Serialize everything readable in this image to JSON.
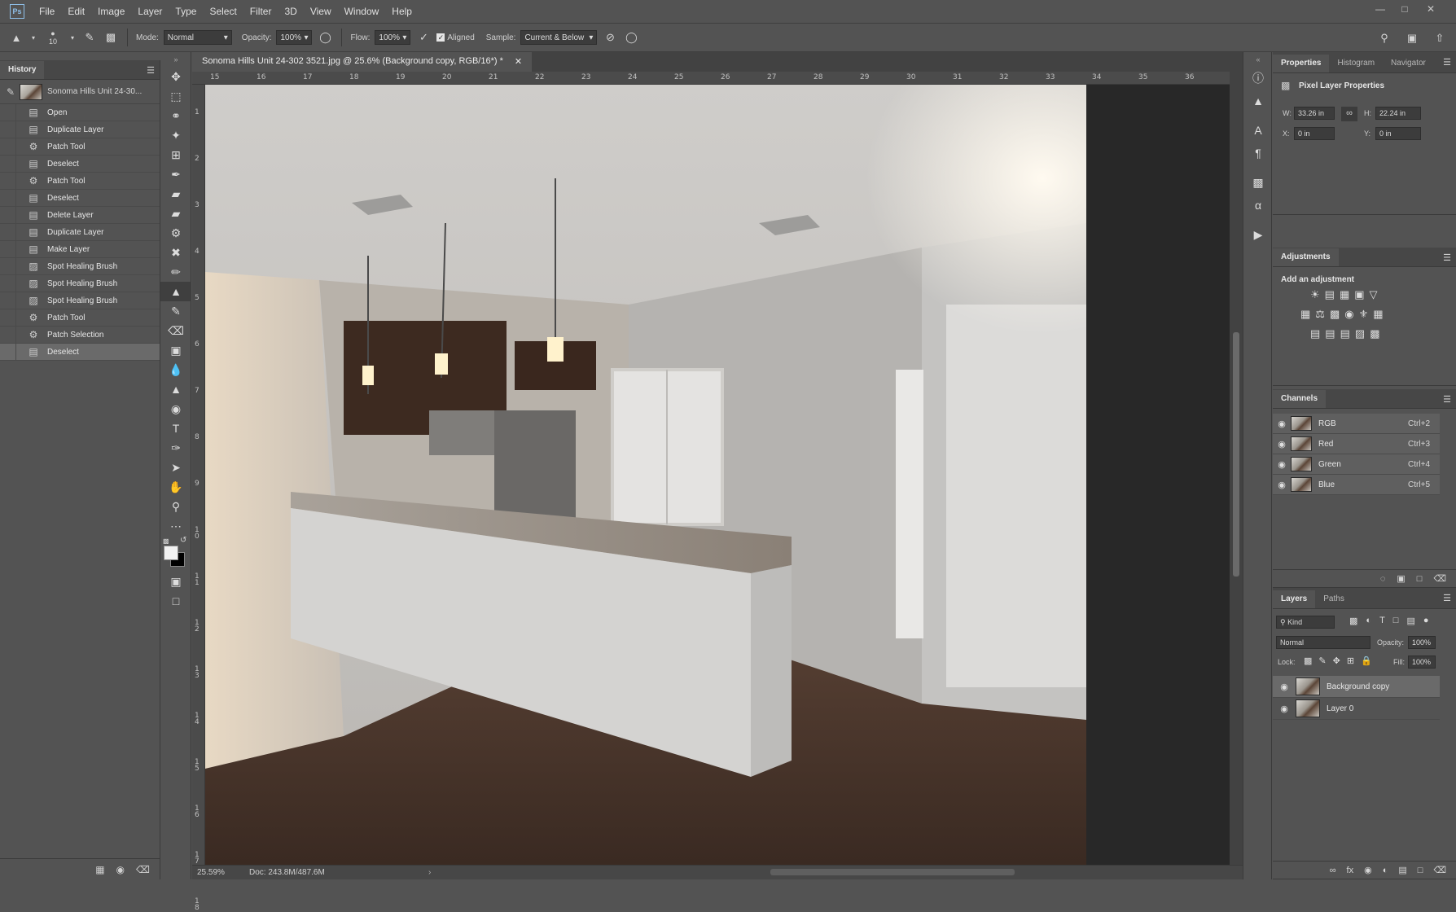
{
  "menubar": {
    "logo": "Ps",
    "items": [
      "File",
      "Edit",
      "Image",
      "Layer",
      "Type",
      "Select",
      "Filter",
      "3D",
      "View",
      "Window",
      "Help"
    ]
  },
  "options": {
    "brush_size": "10",
    "mode_label": "Mode:",
    "mode_value": "Normal",
    "opacity_label": "Opacity:",
    "opacity_value": "100%",
    "flow_label": "Flow:",
    "flow_value": "100%",
    "aligned_label": "Aligned",
    "sample_label": "Sample:",
    "sample_value": "Current & Below"
  },
  "history": {
    "tab_label": "History",
    "snapshot_label": "Sonoma Hills Unit 24-30...",
    "items": [
      {
        "label": "Open",
        "icon": "document-icon"
      },
      {
        "label": "Duplicate Layer",
        "icon": "document-icon"
      },
      {
        "label": "Patch Tool",
        "icon": "patch-icon"
      },
      {
        "label": "Deselect",
        "icon": "document-icon"
      },
      {
        "label": "Patch Tool",
        "icon": "patch-icon"
      },
      {
        "label": "Deselect",
        "icon": "document-icon"
      },
      {
        "label": "Delete Layer",
        "icon": "document-icon"
      },
      {
        "label": "Duplicate Layer",
        "icon": "document-icon"
      },
      {
        "label": "Make Layer",
        "icon": "document-icon"
      },
      {
        "label": "Spot Healing Brush",
        "icon": "bandage-icon"
      },
      {
        "label": "Spot Healing Brush",
        "icon": "bandage-icon"
      },
      {
        "label": "Spot Healing Brush",
        "icon": "bandage-icon"
      },
      {
        "label": "Patch Tool",
        "icon": "patch-icon"
      },
      {
        "label": "Patch Selection",
        "icon": "patch-icon"
      },
      {
        "label": "Deselect",
        "icon": "document-icon"
      }
    ]
  },
  "document": {
    "tab_title": "Sonoma Hills Unit 24-302 3521.jpg @ 25.6% (Background copy, RGB/16*) *",
    "zoom": "25.59%",
    "doc_size": "Doc: 243.8M/487.6M",
    "ruler_top": [
      "15",
      "16",
      "17",
      "18",
      "19",
      "20",
      "21",
      "22",
      "23",
      "24",
      "25",
      "26",
      "27",
      "28",
      "29",
      "30",
      "31",
      "32",
      "33",
      "34",
      "35",
      "36"
    ],
    "ruler_left": [
      "1",
      "2",
      "3",
      "4",
      "5",
      "6",
      "7",
      "8",
      "9",
      "1 0",
      "1 1",
      "1 2",
      "1 3",
      "1 4",
      "1 5",
      "1 6",
      "1 7",
      "1 8"
    ]
  },
  "properties": {
    "tabs": [
      "Properties",
      "Histogram",
      "Navigator"
    ],
    "section_title": "Pixel Layer Properties",
    "w_label": "W:",
    "w_value": "33.26 in",
    "h_label": "H:",
    "h_value": "22.24 in",
    "x_label": "X:",
    "x_value": "0 in",
    "y_label": "Y:",
    "y_value": "0 in"
  },
  "adjustments": {
    "tab_label": "Adjustments",
    "subtitle": "Add an adjustment"
  },
  "channels": {
    "tab_label": "Channels",
    "items": [
      {
        "name": "RGB",
        "shortcut": "Ctrl+2"
      },
      {
        "name": "Red",
        "shortcut": "Ctrl+3"
      },
      {
        "name": "Green",
        "shortcut": "Ctrl+4"
      },
      {
        "name": "Blue",
        "shortcut": "Ctrl+5"
      }
    ]
  },
  "layers": {
    "tabs": [
      "Layers",
      "Paths"
    ],
    "kind_label": "Kind",
    "blend_mode": "Normal",
    "opacity_label": "Opacity:",
    "opacity_value": "100%",
    "lock_label": "Lock:",
    "fill_label": "Fill:",
    "fill_value": "100%",
    "items": [
      {
        "name": "Background copy"
      },
      {
        "name": "Layer 0"
      }
    ]
  }
}
